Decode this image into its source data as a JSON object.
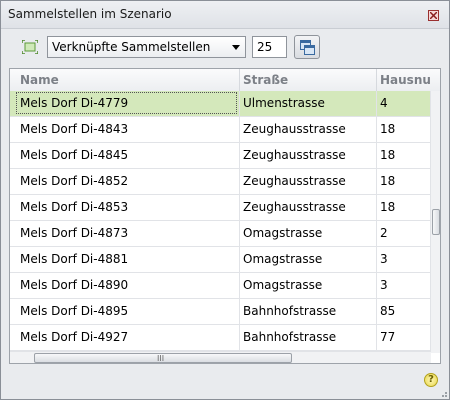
{
  "window": {
    "title": "Sammelstellen im Szenario"
  },
  "toolbar": {
    "selector_value": "Verknüpfte Sammelstellen",
    "count_value": "25"
  },
  "table": {
    "columns": [
      "Name",
      "Straße",
      "Hausnu"
    ],
    "rows": [
      {
        "name": "Mels Dorf Di-4779",
        "strasse": "Ulmenstrasse",
        "hausnr": "4",
        "selected": true
      },
      {
        "name": "Mels Dorf Di-4843",
        "strasse": "Zeughausstrasse",
        "hausnr": "18"
      },
      {
        "name": "Mels Dorf Di-4845",
        "strasse": "Zeughausstrasse",
        "hausnr": "18"
      },
      {
        "name": "Mels Dorf Di-4852",
        "strasse": "Zeughausstrasse",
        "hausnr": "18"
      },
      {
        "name": "Mels Dorf Di-4853",
        "strasse": "Zeughausstrasse",
        "hausnr": "18"
      },
      {
        "name": "Mels Dorf Di-4873",
        "strasse": "Omagstrasse",
        "hausnr": "2"
      },
      {
        "name": "Mels Dorf Di-4881",
        "strasse": "Omagstrasse",
        "hausnr": "3"
      },
      {
        "name": "Mels Dorf Di-4890",
        "strasse": "Omagstrasse",
        "hausnr": "3"
      },
      {
        "name": "Mels Dorf Di-4895",
        "strasse": "Bahnhofstrasse",
        "hausnr": "85"
      },
      {
        "name": "Mels Dorf Di-4927",
        "strasse": "Bahnhofstrasse",
        "hausnr": "77"
      }
    ]
  },
  "scrollbar": {
    "grip": "III"
  },
  "help": {
    "label": "?"
  },
  "colors": {
    "selected_row": "#d4e8bb",
    "header_text": "#7c8087"
  }
}
